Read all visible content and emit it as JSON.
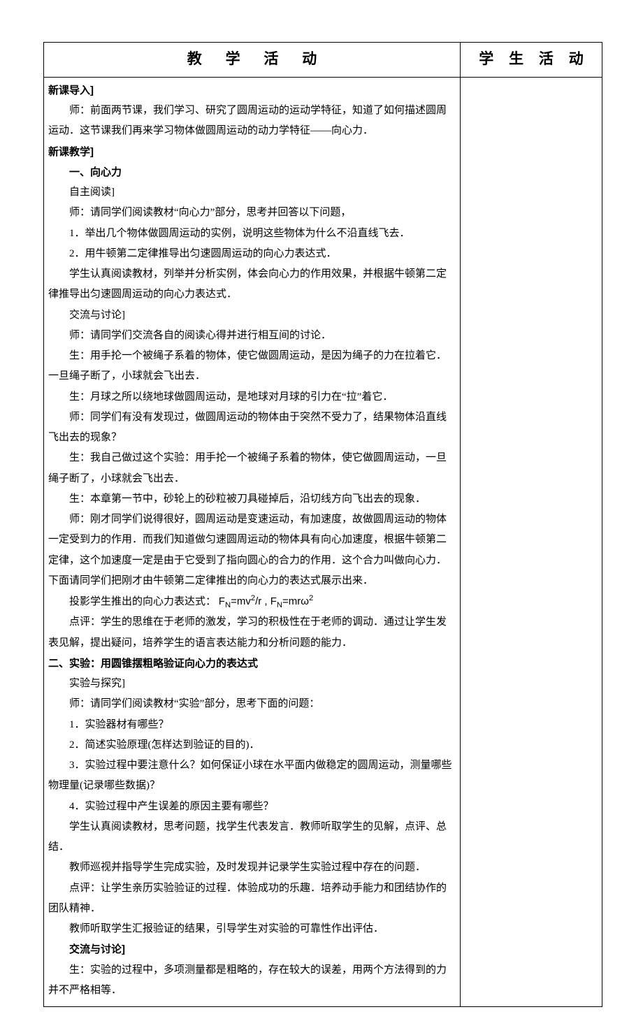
{
  "headers": {
    "teaching": "教 学 活 动",
    "student": "学 生 活 动"
  },
  "content": {
    "h1": "新课导入]",
    "p1": "师：前面两节课，我们学习、研究了圆周运动的运动学特征，知道了如何描述圆周运动．这节课我们再来学习物体做圆周运动的动力学特征——向心力．",
    "h2": "新课教学]",
    "s1_title": "一、向心力",
    "s1_sub1": "自主阅读]",
    "s1_p1": "师：请同学们阅读教材“向心力”部分，思考并回答以下问题，",
    "s1_p2": "1．举出几个物体做圆周运动的实例，说明这些物体为什么不沿直线飞去．",
    "s1_p3": "2．用牛顿第二定律推导出匀速圆周运动的向心力表达式．",
    "s1_p4": "学生认真阅读教材，列举并分析实例，体会向心力的作用效果，并根据牛顿第二定律推导出匀速圆周运动的向心力表达式．",
    "s1_sub2": "交流与讨论]",
    "s1_p5": "师：请同学们交流各自的阅读心得并进行相互间的讨论．",
    "s1_p6": "生：用手抡一个被绳子系着的物体，使它做圆周运动，是因为绳子的力在拉着它．一旦绳子断了，小球就会飞出去．",
    "s1_p7": "生：月球之所以绕地球做圆周运动，是地球对月球的引力在“拉”着它．",
    "s1_p8": "师：同学们有没有发现过，做圆周运动的物体由于突然不受力了，结果物体沿直线飞出去的现象？",
    "s1_p9": "生：我自己做过这个实验：用手抡一个被绳子系着的物体，使它做圆周运动，一旦绳子断了，小球就会飞出去．",
    "s1_p10": "生：本章第一节中，砂轮上的砂粒被刀具碰掉后，沿切线方向飞出去的现象．",
    "s1_p11": "师：刚才同学们说得很好，圆周运动是变速运动，有加速度，故做圆周运动的物体一定受到力的作用．而我们知道做匀速圆周运动的物体具有向心加速度，根据牛顿第二定律，这个加速度一定是由于它受到了指向圆心的合力的作用．这个合力叫做向心力．下面请同学们把刚才由牛顿第二定律推出的向心力的表达式展示出来．",
    "s1_p12a": "投影学生推出的向心力表达式：",
    "s1_p12b": "F",
    "s1_p12c": "N",
    "s1_p12d": "=mv",
    "s1_p12e": "2",
    "s1_p12f": "/r , F",
    "s1_p12g": "N",
    "s1_p12h": "=mrω",
    "s1_p12i": "2",
    "s1_p13": "点评：学生的思维在于老师的激发，学习的积极性在于老师的调动．通过让学生发表见解，提出疑问，培养学生的语言表达能力和分析问题的能力．",
    "s2_title": "二、实验：用圆锥摆粗略验证向心力的表达式",
    "s2_sub1": "实验与探究]",
    "s2_p1": "师：请同学们阅读教材“实验”部分，思考下面的问题：",
    "s2_p2": "1．实验器材有哪些？",
    "s2_p3": "2．简述实验原理(怎样达到验证的目的)．",
    "s2_p4": "3．实验过程中要注意什么？如何保证小球在水平面内做稳定的圆周运动，测量哪些物理量(记录哪些数据)？",
    "s2_p5": "4．实验过程中产生误差的原因主要有哪些？",
    "s2_p6": "学生认真阅读教材，思考问题，找学生代表发言．教师听取学生的见解，点评、总结．",
    "s2_p7": "教师巡视并指导学生完成实验，及时发现并记录学生实验过程中存在的问题．",
    "s2_p8": "点评：让学生亲历实验验证的过程．体验成功的乐趣．培养动手能力和团结协作的团队精神．",
    "s2_p9": "教师听取学生汇报验证的结果，引导学生对实验的可靠性作出评估．",
    "s2_sub2": "交流与讨论]",
    "s2_p10": "生：实验的过程中，多项测量都是粗略的，存在较大的误差，用两个方法得到的力并不严格相等．",
    "right_body": ""
  }
}
